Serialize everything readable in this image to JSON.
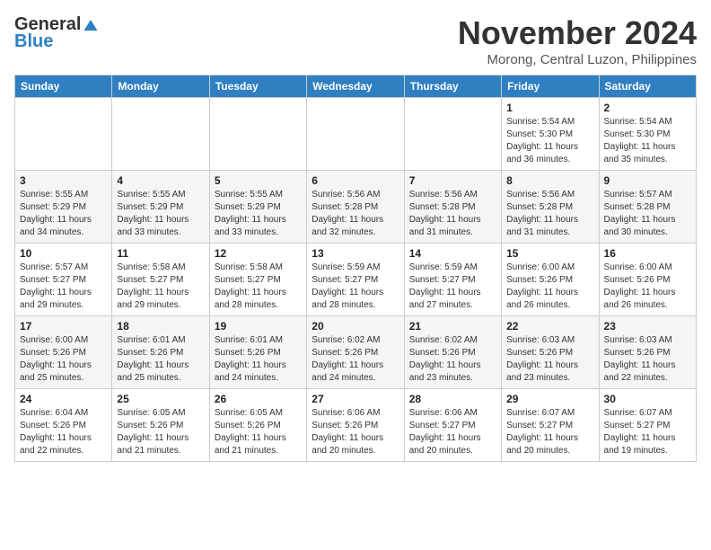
{
  "header": {
    "logo_general": "General",
    "logo_blue": "Blue",
    "month": "November 2024",
    "location": "Morong, Central Luzon, Philippines"
  },
  "weekdays": [
    "Sunday",
    "Monday",
    "Tuesday",
    "Wednesday",
    "Thursday",
    "Friday",
    "Saturday"
  ],
  "weeks": [
    [
      {
        "day": "",
        "info": ""
      },
      {
        "day": "",
        "info": ""
      },
      {
        "day": "",
        "info": ""
      },
      {
        "day": "",
        "info": ""
      },
      {
        "day": "",
        "info": ""
      },
      {
        "day": "1",
        "info": "Sunrise: 5:54 AM\nSunset: 5:30 PM\nDaylight: 11 hours and 36 minutes."
      },
      {
        "day": "2",
        "info": "Sunrise: 5:54 AM\nSunset: 5:30 PM\nDaylight: 11 hours and 35 minutes."
      }
    ],
    [
      {
        "day": "3",
        "info": "Sunrise: 5:55 AM\nSunset: 5:29 PM\nDaylight: 11 hours and 34 minutes."
      },
      {
        "day": "4",
        "info": "Sunrise: 5:55 AM\nSunset: 5:29 PM\nDaylight: 11 hours and 33 minutes."
      },
      {
        "day": "5",
        "info": "Sunrise: 5:55 AM\nSunset: 5:29 PM\nDaylight: 11 hours and 33 minutes."
      },
      {
        "day": "6",
        "info": "Sunrise: 5:56 AM\nSunset: 5:28 PM\nDaylight: 11 hours and 32 minutes."
      },
      {
        "day": "7",
        "info": "Sunrise: 5:56 AM\nSunset: 5:28 PM\nDaylight: 11 hours and 31 minutes."
      },
      {
        "day": "8",
        "info": "Sunrise: 5:56 AM\nSunset: 5:28 PM\nDaylight: 11 hours and 31 minutes."
      },
      {
        "day": "9",
        "info": "Sunrise: 5:57 AM\nSunset: 5:28 PM\nDaylight: 11 hours and 30 minutes."
      }
    ],
    [
      {
        "day": "10",
        "info": "Sunrise: 5:57 AM\nSunset: 5:27 PM\nDaylight: 11 hours and 29 minutes."
      },
      {
        "day": "11",
        "info": "Sunrise: 5:58 AM\nSunset: 5:27 PM\nDaylight: 11 hours and 29 minutes."
      },
      {
        "day": "12",
        "info": "Sunrise: 5:58 AM\nSunset: 5:27 PM\nDaylight: 11 hours and 28 minutes."
      },
      {
        "day": "13",
        "info": "Sunrise: 5:59 AM\nSunset: 5:27 PM\nDaylight: 11 hours and 28 minutes."
      },
      {
        "day": "14",
        "info": "Sunrise: 5:59 AM\nSunset: 5:27 PM\nDaylight: 11 hours and 27 minutes."
      },
      {
        "day": "15",
        "info": "Sunrise: 6:00 AM\nSunset: 5:26 PM\nDaylight: 11 hours and 26 minutes."
      },
      {
        "day": "16",
        "info": "Sunrise: 6:00 AM\nSunset: 5:26 PM\nDaylight: 11 hours and 26 minutes."
      }
    ],
    [
      {
        "day": "17",
        "info": "Sunrise: 6:00 AM\nSunset: 5:26 PM\nDaylight: 11 hours and 25 minutes."
      },
      {
        "day": "18",
        "info": "Sunrise: 6:01 AM\nSunset: 5:26 PM\nDaylight: 11 hours and 25 minutes."
      },
      {
        "day": "19",
        "info": "Sunrise: 6:01 AM\nSunset: 5:26 PM\nDaylight: 11 hours and 24 minutes."
      },
      {
        "day": "20",
        "info": "Sunrise: 6:02 AM\nSunset: 5:26 PM\nDaylight: 11 hours and 24 minutes."
      },
      {
        "day": "21",
        "info": "Sunrise: 6:02 AM\nSunset: 5:26 PM\nDaylight: 11 hours and 23 minutes."
      },
      {
        "day": "22",
        "info": "Sunrise: 6:03 AM\nSunset: 5:26 PM\nDaylight: 11 hours and 23 minutes."
      },
      {
        "day": "23",
        "info": "Sunrise: 6:03 AM\nSunset: 5:26 PM\nDaylight: 11 hours and 22 minutes."
      }
    ],
    [
      {
        "day": "24",
        "info": "Sunrise: 6:04 AM\nSunset: 5:26 PM\nDaylight: 11 hours and 22 minutes."
      },
      {
        "day": "25",
        "info": "Sunrise: 6:05 AM\nSunset: 5:26 PM\nDaylight: 11 hours and 21 minutes."
      },
      {
        "day": "26",
        "info": "Sunrise: 6:05 AM\nSunset: 5:26 PM\nDaylight: 11 hours and 21 minutes."
      },
      {
        "day": "27",
        "info": "Sunrise: 6:06 AM\nSunset: 5:26 PM\nDaylight: 11 hours and 20 minutes."
      },
      {
        "day": "28",
        "info": "Sunrise: 6:06 AM\nSunset: 5:27 PM\nDaylight: 11 hours and 20 minutes."
      },
      {
        "day": "29",
        "info": "Sunrise: 6:07 AM\nSunset: 5:27 PM\nDaylight: 11 hours and 20 minutes."
      },
      {
        "day": "30",
        "info": "Sunrise: 6:07 AM\nSunset: 5:27 PM\nDaylight: 11 hours and 19 minutes."
      }
    ]
  ]
}
